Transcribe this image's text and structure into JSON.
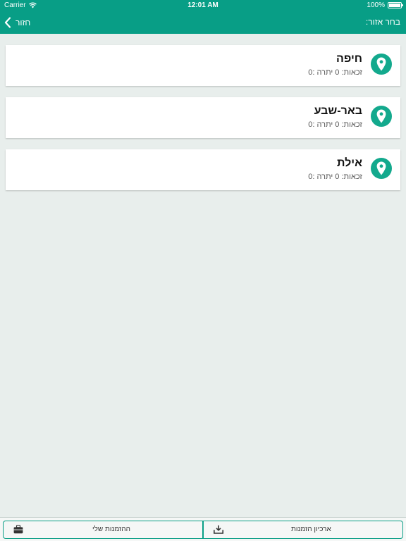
{
  "status_bar": {
    "carrier": "Carrier",
    "time": "12:01 AM",
    "battery": "100%"
  },
  "nav": {
    "title": "בחר אזור:",
    "back_label": "חזור"
  },
  "regions": [
    {
      "name": "חיפה",
      "details": "זכאות: 0 יתרה :0"
    },
    {
      "name": "באר-שבע",
      "details": "זכאות: 0 יתרה :0"
    },
    {
      "name": "אילת",
      "details": "זכאות: 0 יתרה :0"
    }
  ],
  "tabs": {
    "my_orders": "ההזמנות שלי",
    "orders_archive": "ארכיון הזמנות"
  },
  "colors": {
    "accent": "#089e86",
    "pin": "#13a98d",
    "background": "#e8eeec"
  },
  "icons": {
    "region": "map-pin-icon",
    "back": "chevron-left-icon",
    "my_orders": "briefcase-icon",
    "archive": "download-tray-icon"
  }
}
